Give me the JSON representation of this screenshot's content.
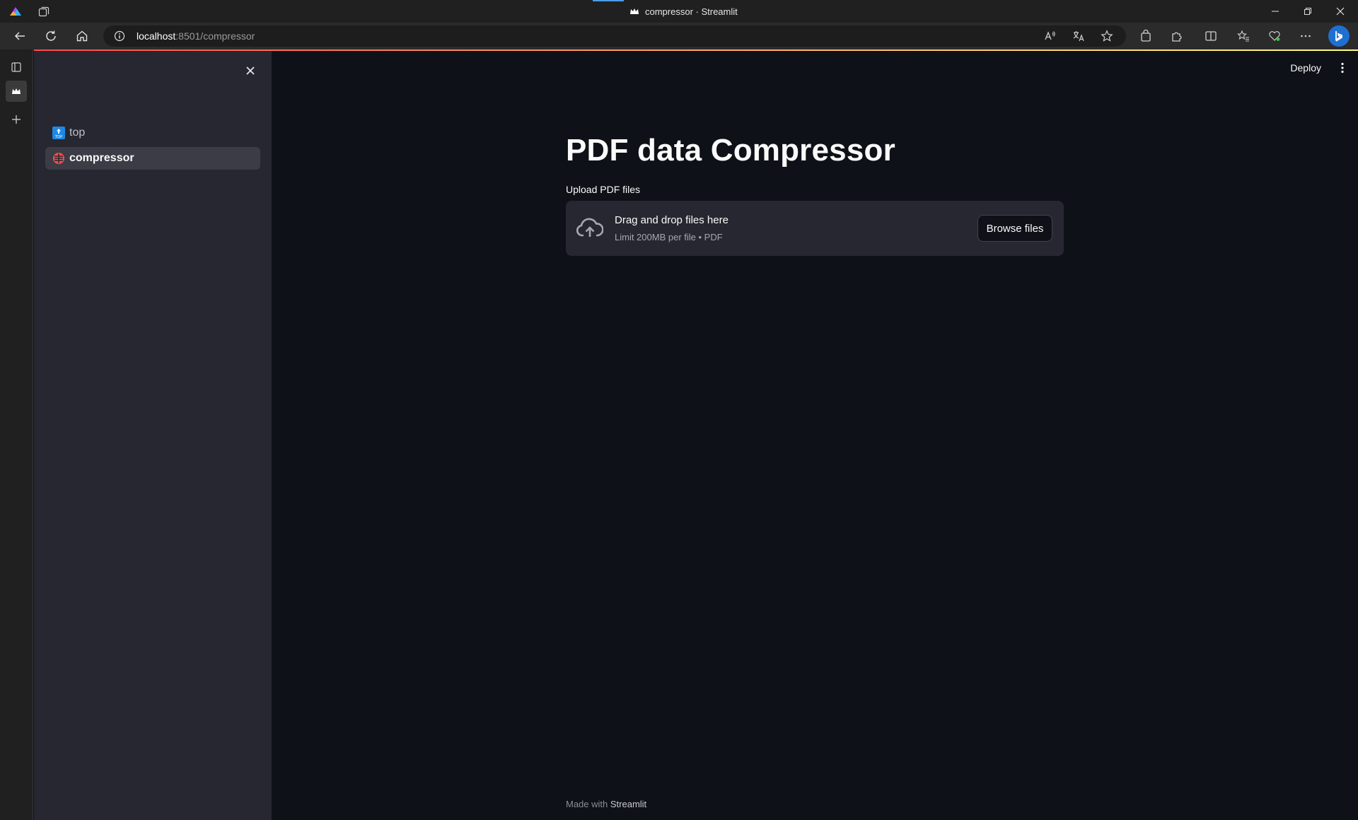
{
  "browser": {
    "tab_title": "compressor · Streamlit",
    "url_host": "localhost",
    "url_path": ":8501/compressor"
  },
  "sidebar": {
    "items": [
      {
        "label": "top",
        "icon": "top-arrow-icon",
        "active": false
      },
      {
        "label": "compressor",
        "icon": "red-compressor-icon",
        "active": true
      }
    ]
  },
  "header": {
    "deploy_label": "Deploy"
  },
  "main": {
    "title": "PDF data Compressor",
    "uploader": {
      "label": "Upload PDF files",
      "drop_text": "Drag and drop files here",
      "limit_text": "Limit 200MB per file • PDF",
      "browse_label": "Browse files"
    }
  },
  "footer": {
    "prefix": "Made with",
    "brand": "Streamlit"
  },
  "colors": {
    "background": "#0e1117",
    "sidebar": "#262730",
    "accent": "#ff4b4b"
  }
}
